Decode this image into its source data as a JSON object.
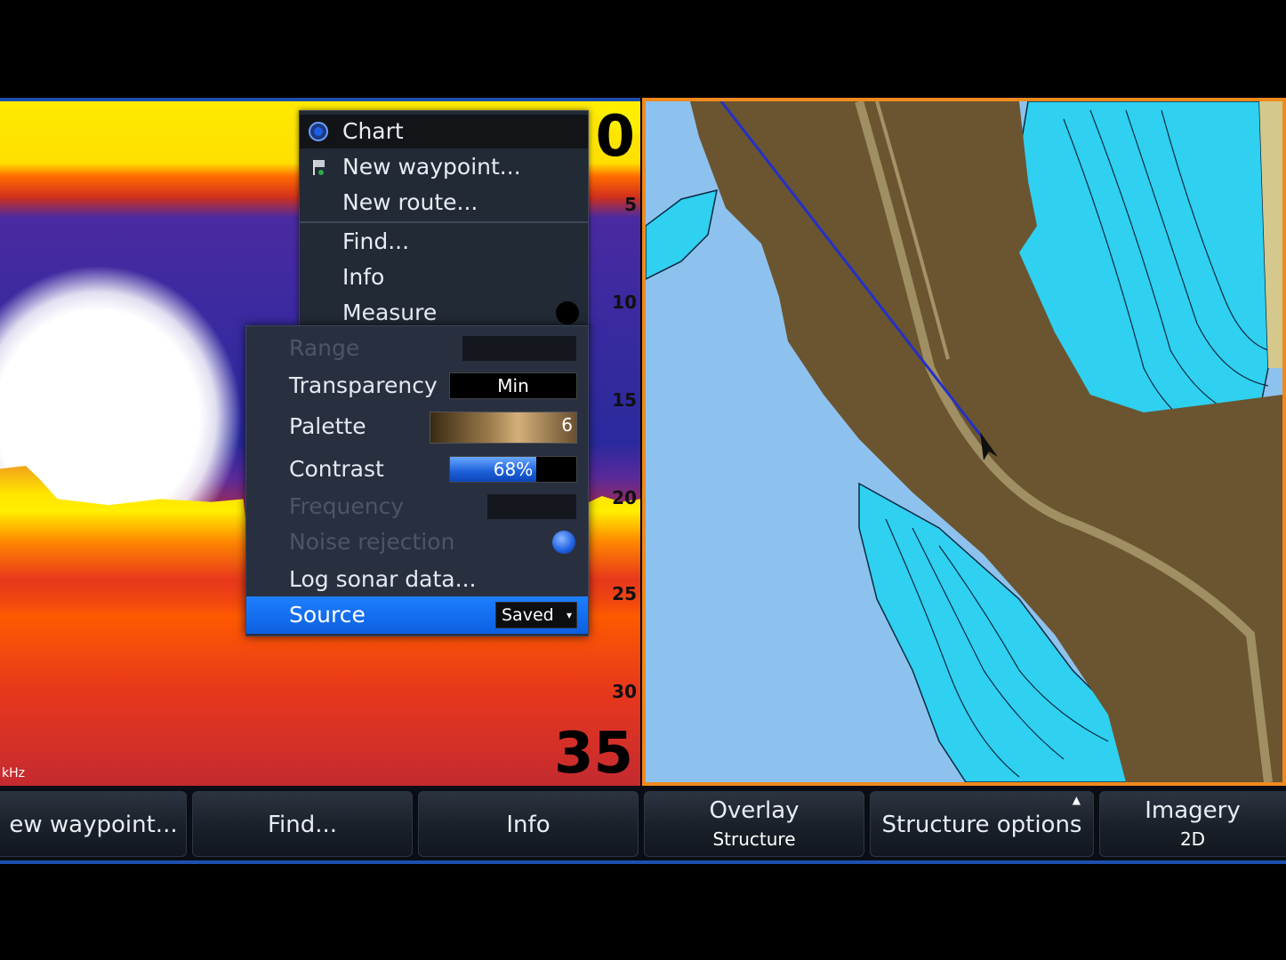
{
  "sonar": {
    "depth_top": "0",
    "depth_bottom": "35",
    "scale_ticks": [
      "5",
      "10",
      "15",
      "20",
      "25",
      "30"
    ],
    "frequency_label": "kHz"
  },
  "context_menu": {
    "items": [
      {
        "label": "Chart",
        "icon": "radio-selected-icon",
        "active": true
      },
      {
        "label": "New waypoint...",
        "icon": "waypoint-flag-icon"
      },
      {
        "label": "New route..."
      },
      {
        "label": "Find..."
      },
      {
        "label": "Info"
      },
      {
        "label": "Measure"
      }
    ]
  },
  "submenu": {
    "range": {
      "label": "Range",
      "enabled": false
    },
    "transparency": {
      "label": "Transparency",
      "value": "Min"
    },
    "palette": {
      "label": "Palette",
      "value": "6"
    },
    "contrast": {
      "label": "Contrast",
      "value": "68%",
      "percent": 68
    },
    "frequency": {
      "label": "Frequency",
      "enabled": false
    },
    "noise_rejection": {
      "label": "Noise rejection",
      "enabled": false
    },
    "log_sonar": {
      "label": "Log sonar data..."
    },
    "source": {
      "label": "Source",
      "value": "Saved",
      "selected": true
    }
  },
  "softkeys": [
    {
      "label": "ew waypoint..."
    },
    {
      "label": "Find..."
    },
    {
      "label": "Info"
    },
    {
      "label": "Overlay",
      "value": "Structure"
    },
    {
      "label": "Structure options"
    },
    {
      "label": "Imagery",
      "value": "2D"
    }
  ],
  "colors": {
    "sonar_border": "#1d4fae",
    "chart_border": "#f08a1e",
    "selection_blue": "#1d7fff",
    "water_light": "#8ec2ee",
    "shallow_cyan": "#2fd0f0",
    "structure_brown": "#6a5530"
  }
}
